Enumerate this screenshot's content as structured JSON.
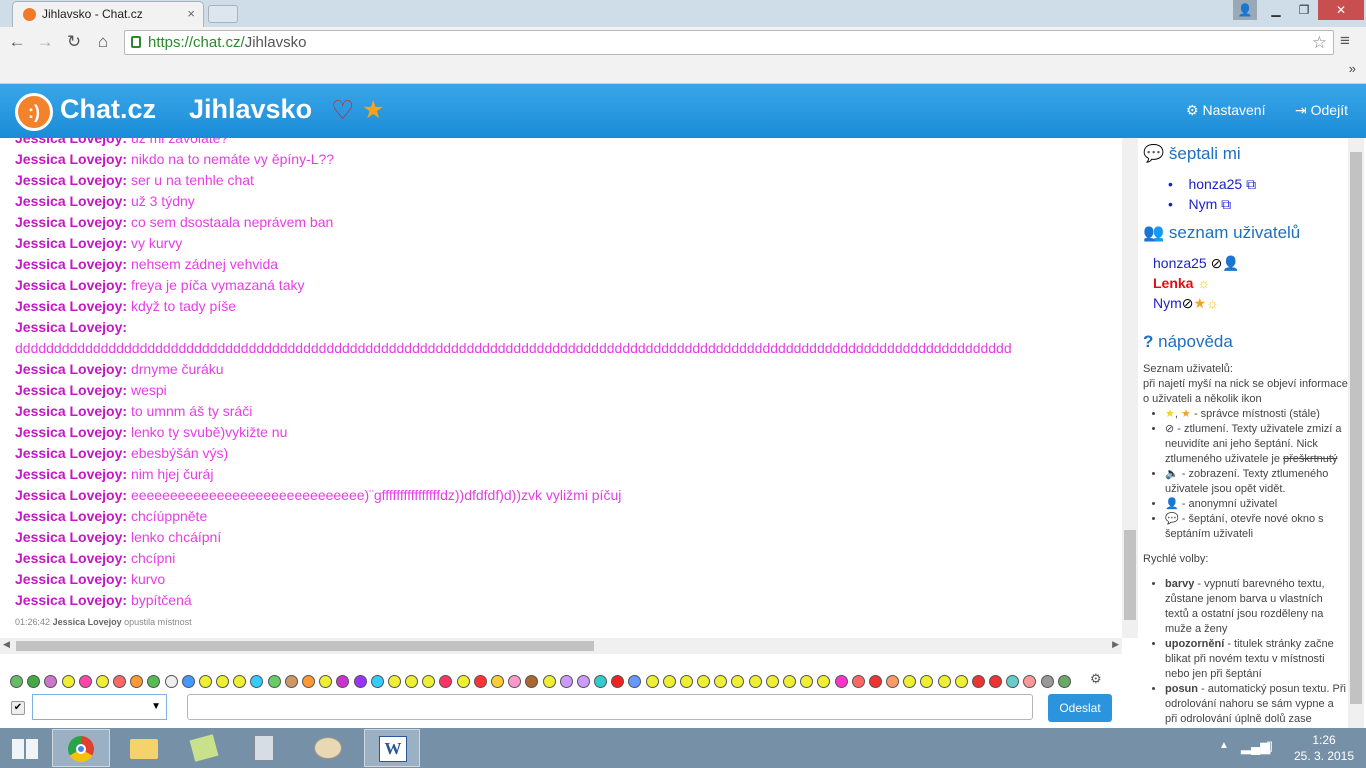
{
  "browser": {
    "tab_title": "Jihlavsko - Chat.cz",
    "url_host": "https://chat.cz/",
    "url_path": "Jihlavsko"
  },
  "site": {
    "brand": "Chat.cz",
    "room": "Jihlavsko",
    "settings_label": "Nastavení",
    "logout_label": "Odejít"
  },
  "messages": [
    {
      "nick": "Jessica Lovejoy:",
      "text": "už mi zavoláte?"
    },
    {
      "nick": "Jessica Lovejoy:",
      "text": "nikdo na to nemáte vy ěpíny-L??"
    },
    {
      "nick": "Jessica Lovejoy:",
      "text": "ser u na tenhle chat"
    },
    {
      "nick": "Jessica Lovejoy:",
      "text": "už 3 týdny"
    },
    {
      "nick": "Jessica Lovejoy:",
      "text": "co sem dsostaala neprávem ban"
    },
    {
      "nick": "Jessica Lovejoy:",
      "text": "vy kurvy"
    },
    {
      "nick": "Jessica Lovejoy:",
      "text": "nehsem zádnej vehvida"
    },
    {
      "nick": "Jessica Lovejoy:",
      "text": "freya je píča vymazaná taky"
    },
    {
      "nick": "Jessica Lovejoy:",
      "text": "když to tady píše"
    },
    {
      "nick": "Jessica Lovejoy:",
      "text": ""
    },
    {
      "nick": "",
      "text": "dddddddddddddddddddddddddddddddddddddddddddddddddddddddddddddddddddddddddddddddddddddddddddddddddddddddddddddddddddddddddddddddd"
    },
    {
      "nick": "Jessica Lovejoy:",
      "text": "drnyme čuráku"
    },
    {
      "nick": "Jessica Lovejoy:",
      "text": "wespi"
    },
    {
      "nick": "Jessica Lovejoy:",
      "text": "to umnm áš ty sráči"
    },
    {
      "nick": "Jessica Lovejoy:",
      "text": "lenko ty svubě)vykižte nu"
    },
    {
      "nick": "Jessica Lovejoy:",
      "text": "ebesbýšán výs)"
    },
    {
      "nick": "Jessica Lovejoy:",
      "text": "nim hjej čuráj"
    },
    {
      "nick": "Jessica Lovejoy:",
      "text": "eeeeeeeeeeeeeeeeeeeeeeeeeeeeee)¨gffffffffffffffffdz))dfdfdf)d))zvk vyližmi píčuj"
    },
    {
      "nick": "Jessica Lovejoy:",
      "text": "chcíúppněte"
    },
    {
      "nick": "Jessica Lovejoy:",
      "text": "lenko chcáípní"
    },
    {
      "nick": "Jessica Lovejoy:",
      "text": "chcípni"
    },
    {
      "nick": "Jessica Lovejoy:",
      "text": "kurvo"
    },
    {
      "nick": "Jessica Lovejoy:",
      "text": "bypítčená"
    }
  ],
  "system_message": {
    "time": "01:26:42",
    "nick": "Jessica Lovejoy",
    "text": "opustila místnost"
  },
  "sidebar": {
    "whispered_title": "šeptali mi",
    "whispered": [
      "honza25",
      "Nym"
    ],
    "users_title": "seznam uživatelů",
    "users": [
      "honza25",
      "Lenka",
      "Nym"
    ],
    "help_title": "nápověda",
    "help_intro_1": "Seznam uživatelů:",
    "help_intro_2": "při najetí myší na nick se objeví informace o uživateli a několik ikon",
    "help_items": [
      "- správce místnosti (stále)",
      "- ztlumení. Texty uživatele zmizí a neuvidíte ani jeho šeptání. Nick ztlumeného uživatele je",
      "- zobrazení. Texty ztlumeného uživatele jsou opět vidět.",
      "- anonymní uživatel",
      "- šeptání, otevře nové okno s šeptáním uživateli"
    ],
    "help_strike": "přeškrtnutý",
    "quick_title": "Rychlé volby:",
    "quick_items": [
      {
        "key": "barvy",
        "text": " - vypnutí barevného textu, zůstane jenom barva u vlastních textů a ostatní jsou rozděleny na ",
        "extra": "muže a ženy"
      },
      {
        "key": "upozornění",
        "text": " - titulek stránky začne blikat při novém textu v místnosti nebo jen při šeptání",
        "extra": ""
      },
      {
        "key": "posun",
        "text": " - automatický posun textu. Při odrolování nahoru se sám vypne a při odrolování úplně dolů zase",
        "extra": ""
      }
    ]
  },
  "input": {
    "send_label": "Odeslat"
  },
  "taskbar": {
    "time": "1:26",
    "date": "25. 3. 2015"
  }
}
